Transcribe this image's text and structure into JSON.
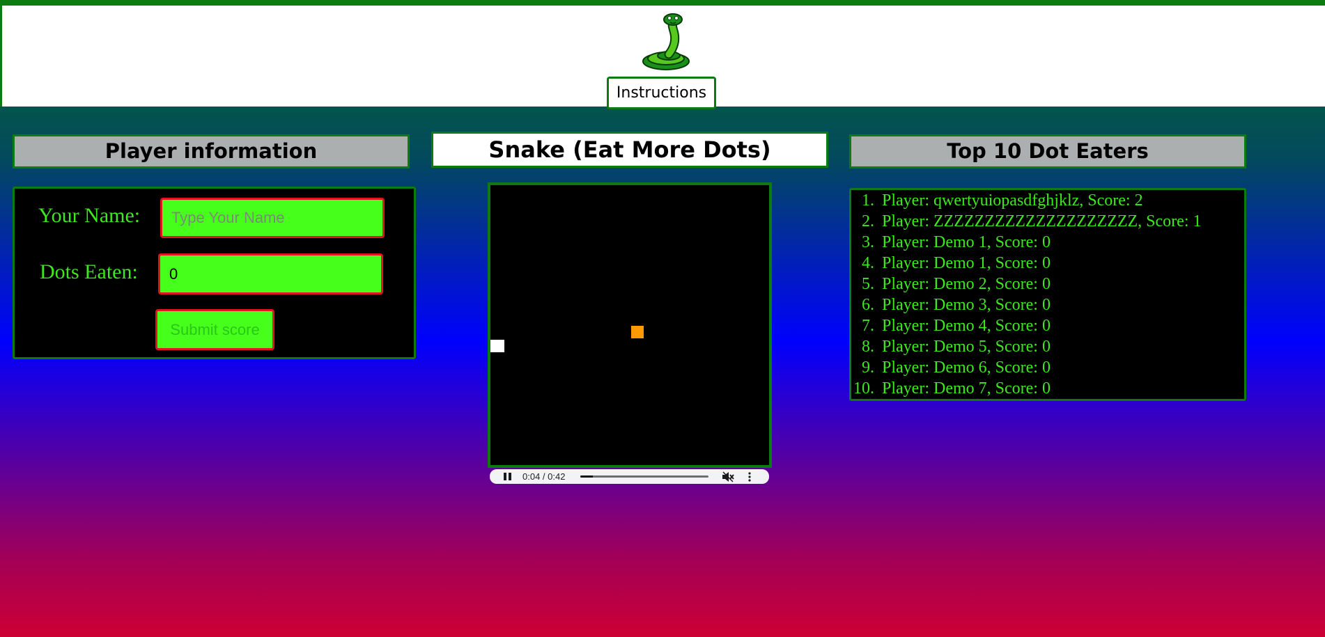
{
  "header": {
    "logo_icon": "snake-logo-icon",
    "instructions_label": "Instructions"
  },
  "player_panel": {
    "title": "Player information",
    "name_label": "Your Name:",
    "name_placeholder": "Type Your Name",
    "name_value": "",
    "dots_label": "Dots Eaten:",
    "dots_value": "0",
    "submit_label": "Submit score"
  },
  "game": {
    "title": "Snake (Eat More Dots)",
    "food_color": "#ff9a00",
    "snake_color": "#ffffff",
    "video": {
      "time": "0:04 / 0:42",
      "progress": 0.1,
      "play_state_icon": "pause-icon",
      "mute_icon": "muted-speaker-icon",
      "menu_icon": "more-vert-icon"
    }
  },
  "leaderboard": {
    "title": "Top 10 Dot Eaters",
    "entries": [
      {
        "rank": "1.",
        "text": "Player: qwertyuiopasdfghjklz, Score: 2"
      },
      {
        "rank": "2.",
        "text": "Player: ZZZZZZZZZZZZZZZZZZZZ, Score: 1"
      },
      {
        "rank": "3.",
        "text": "Player: Demo 1, Score: 0"
      },
      {
        "rank": "4.",
        "text": "Player: Demo 1, Score: 0"
      },
      {
        "rank": "5.",
        "text": "Player: Demo 2, Score: 0"
      },
      {
        "rank": "6.",
        "text": "Player: Demo 3, Score: 0"
      },
      {
        "rank": "7.",
        "text": "Player: Demo 4, Score: 0"
      },
      {
        "rank": "8.",
        "text": "Player: Demo 5, Score: 0"
      },
      {
        "rank": "9.",
        "text": "Player: Demo 6, Score: 0"
      },
      {
        "rank": "10.",
        "text": "Player: Demo 7, Score: 0"
      }
    ]
  },
  "colors": {
    "border_green": "#0d7a12",
    "text_green": "#3ee81e",
    "input_green": "#46ff1a",
    "input_border_red": "#e2151c"
  }
}
